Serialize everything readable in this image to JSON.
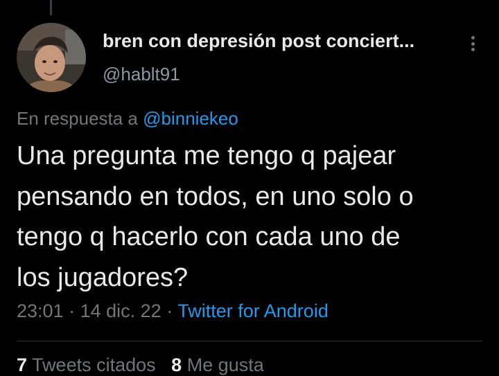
{
  "author": {
    "display_name": "bren con depresión post conciert...",
    "handle": "@hablt91"
  },
  "reply": {
    "prefix": "En respuesta a",
    "mention": "@binniekeo"
  },
  "tweet": {
    "text": "Una pregunta me tengo q pajear\npensando en todos, en uno solo o\ntengo q hacerlo con cada uno de\nlos jugadores?"
  },
  "meta": {
    "time": "23:01",
    "separator": "·",
    "date": "14 dic. 22",
    "source": "Twitter for Android"
  },
  "stats": {
    "retweets_count": "7",
    "retweets_label": "Tweets citados",
    "likes_count": "8",
    "likes_label": "Me gusta"
  },
  "icons": {
    "more": "more-vertical-icon"
  },
  "colors": {
    "background": "#000000",
    "text": "#e7e9ea",
    "secondary": "#71767b",
    "accent": "#1d9bf0"
  }
}
